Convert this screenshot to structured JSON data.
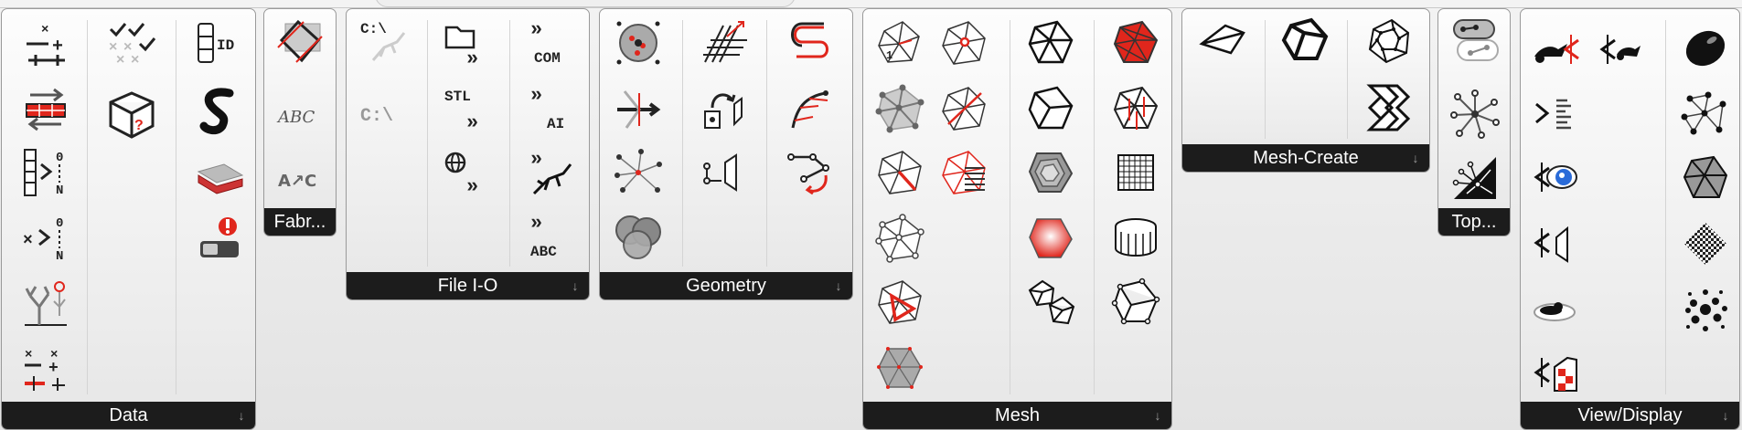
{
  "toolbar": {
    "panels": {
      "data": {
        "label": "Data",
        "has_expand": true
      },
      "fabrication": {
        "label": "Fabr..."
      },
      "file_io": {
        "label": "File I-O",
        "has_expand": true
      },
      "geometry": {
        "label": "Geometry",
        "has_expand": true
      },
      "mesh": {
        "label": "Mesh",
        "has_expand": true
      },
      "mesh_create": {
        "label": "Mesh-Create",
        "has_expand": true
      },
      "topology": {
        "label": "Top..."
      },
      "view_display": {
        "label": "View/Display",
        "has_expand": true
      }
    },
    "icon_text": {
      "id": "ID",
      "c_path": "C:\\",
      "stl": "STL",
      "com": "COM",
      "ai": "AI",
      "abc": "ABC",
      "abc_italic": "ABC",
      "aec": "A↗C",
      "n": "N",
      "zero": "0"
    },
    "expand_glyph": "↓"
  },
  "colors": {
    "accent_red": "#e0261c",
    "label_bar": "#1c1c1c",
    "panel_border": "#9a9a9a"
  }
}
